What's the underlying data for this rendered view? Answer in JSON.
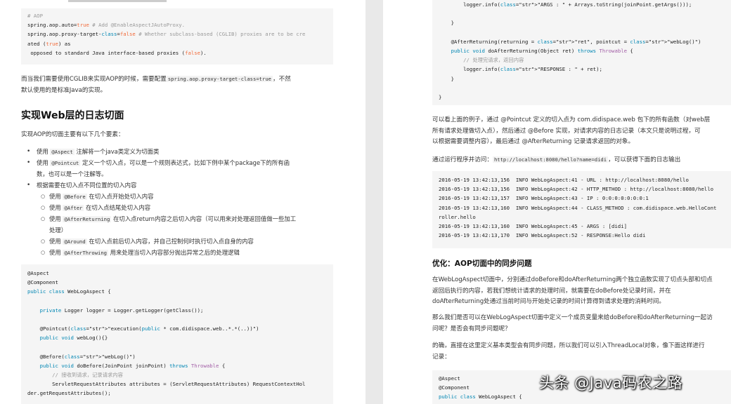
{
  "left": {
    "code1_lines": [
      "# AOP",
      "spring.aop.auto=true # Add @EnableAspectJAutoProxy.",
      "spring.aop.proxy-target-class=false # Whether subclass-based (CGLIB) proxies are to be cre",
      "ated (true) as",
      " opposed to standard Java interface-based proxies (false)."
    ],
    "para1_a": "而当我们需要使用CGLIB来实现AOP的时候，需要配置",
    "para1_code": "spring.aop.proxy-target-class=true",
    "para1_b": "，不然",
    "para1_c": "默认使用的是标准Java的实现。",
    "heading": "实现Web层的日志切面",
    "intro": "实现AOP的切面主要有以下几个要素：",
    "bullets": [
      {
        "pre": "使用 ",
        "code": "@Aspect",
        "post": " 注解将一个java类定义为切面类"
      },
      {
        "pre": "使用 ",
        "code": "@Pointcut",
        "post": " 定义一个切入点，可以是一个规则表达式，比如下例中某个package下的所有函"
      },
      {
        "pre": "",
        "code": "",
        "post": "数，也可以是一个注解等。"
      },
      {
        "pre": "根据需要在切入点不同位置的切入内容",
        "code": "",
        "post": ""
      }
    ],
    "sub_bullets": [
      {
        "pre": "使用 ",
        "code": "@Before",
        "post": " 在切入点开始处切入内容"
      },
      {
        "pre": "使用 ",
        "code": "@After",
        "post": " 在切入点结尾处切入内容"
      },
      {
        "pre": "使用 ",
        "code": "@AfterReturning",
        "post": " 在切入点return内容之后切入内容（可以用来对处理返回值做一些加工"
      },
      {
        "pre": "",
        "code": "",
        "post": "处理）"
      },
      {
        "pre": "使用 ",
        "code": "@Around",
        "post": " 在切入点前后切入内容，并自己控制何时执行切入点自身的内容"
      },
      {
        "pre": "使用 ",
        "code": "@AfterThrowing",
        "post": " 用来处理当切入内容部分抛出异常之后的处理逻辑"
      }
    ],
    "code2_lines": [
      "@Aspect",
      "@Component",
      "public class WebLogAspect {",
      "",
      "    private Logger logger = Logger.getLogger(getClass());",
      "",
      "    @Pointcut(\"execution(public * com.didispace.web..*.*(..))\")",
      "    public void webLog(){}",
      "",
      "    @Before(\"webLog()\")",
      "    public void doBefore(JoinPoint joinPoint) throws Throwable {",
      "        // 接收到请求，记录请求内容",
      "        ServletRequestAttributes attributes = (ServletRequestAttributes) RequestContextHol",
      "der.getRequestAttributes();"
    ]
  },
  "right": {
    "code1_lines": [
      "        logger.info(\"ARGS : \" + Arrays.toString(joinPoint.getArgs()));",
      "",
      "    }",
      "",
      "    @AfterReturning(returning = \"ret\", pointcut = \"webLog()\")",
      "    public void doAfterReturning(Object ret) throws Throwable {",
      "        // 处理完请求，返回内容",
      "        logger.info(\"RESPONSE : \" + ret);",
      "    }",
      "",
      "}"
    ],
    "para1_lines": [
      "可以看上面的例子，通过 @Pointcut 定义的切入点为 com.didispace.web 包下的所有函数（对web层",
      "所有请求处理做切入点），然后通过 @Before 实现，对请求内容的日志记录（本文只是说明过程，可",
      "以根据需要调整内容），最后通过 @AfterReturning 记录请求返回的对象。"
    ],
    "para2_a": "通过运行程序并访问：",
    "para2_code": "http://localhost:8080/hello?name=didi",
    "para2_b": "，可以获得下面的日志输出",
    "log_lines": [
      "2016-05-19 13:42:13,156  INFO WebLogAspect:41 - URL : http://localhost:8080/hello",
      "2016-05-19 13:42:13,156  INFO WebLogAspect:42 - HTTP_METHOD : http://localhost:8080/hello",
      "2016-05-19 13:42:13,157  INFO WebLogAspect:43 - IP : 0:0:0:0:0:0:0:1",
      "2016-05-19 13:42:13,160  INFO WebLogAspect:44 - CLASS_METHOD : com.didispace.web.HelloCont",
      "roller.hello",
      "2016-05-19 13:42:13,160  INFO WebLogAspect:45 - ARGS : [didi]",
      "2016-05-19 13:42:13,170  INFO WebLogAspect:52 - RESPONSE:Hello didi"
    ],
    "heading": "优化：AOP切面中的同步问题",
    "para3_lines": [
      "在WebLogAspect切面中，分别通过doBefore和doAfterReturning两个独立函数实现了切点头部和切点",
      "返回后执行的内容，若我们想统计请求的处理时间，就需要在doBefore处记录时间，并在",
      "doAfterReturning处通过当前时间与开始处记录的时间计算得到请求处理的消耗时间。"
    ],
    "para4_lines": [
      "那么我们是否可以在WebLogAspect切面中定义一个成员变量来给doBefore和doAfterReturning一起访",
      "问呢？是否会有同步问题呢？"
    ],
    "para5_lines": [
      "的确，直接在这里定义基本类型会有同步问题，所以我们可以引入ThreadLocal对象，像下面这样进行",
      "记录："
    ],
    "code3_lines": [
      "@Aspect",
      "@Component",
      "public class WebLogAspect {"
    ],
    "watermark": "头条 @Java码农之路"
  }
}
